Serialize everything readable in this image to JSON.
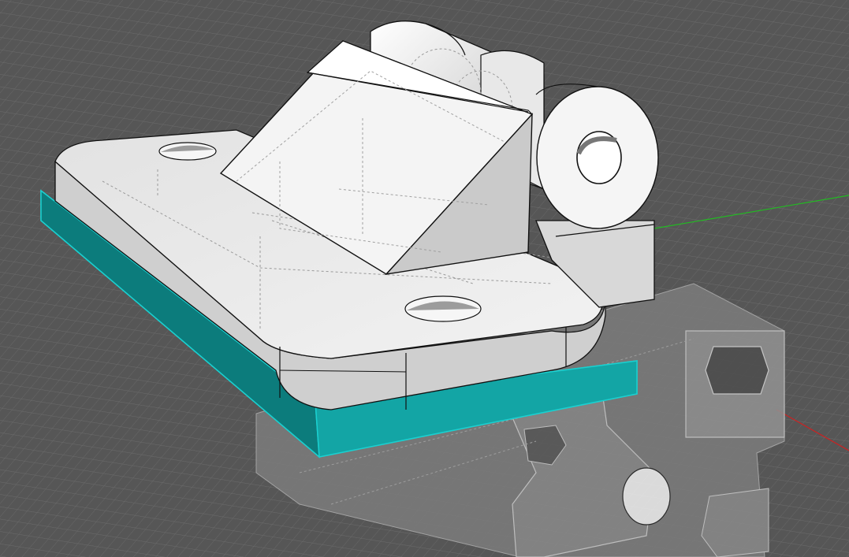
{
  "viewport": {
    "view": "perspective",
    "display_mode": "shaded-with-hidden-lines",
    "grid": true,
    "axes": {
      "x_color": "#cc2222",
      "y_color": "#22bb22"
    }
  },
  "colors": {
    "background": "#565656",
    "grid_line": "#6a6a6a",
    "selection": "#13a5a5",
    "part_fill": "#e6e6e6",
    "edge": "#1a1a1a"
  },
  "scene": {
    "objects": [
      {
        "name": "bracket-base-plate",
        "selected": false
      },
      {
        "name": "hinge-wedge-block",
        "selected": false
      },
      {
        "name": "hinge-cylinder-knuckles",
        "selected": false
      },
      {
        "name": "spacer-plate",
        "selected": true
      },
      {
        "name": "aluminum-extrusion-profile",
        "selected": false
      }
    ]
  }
}
